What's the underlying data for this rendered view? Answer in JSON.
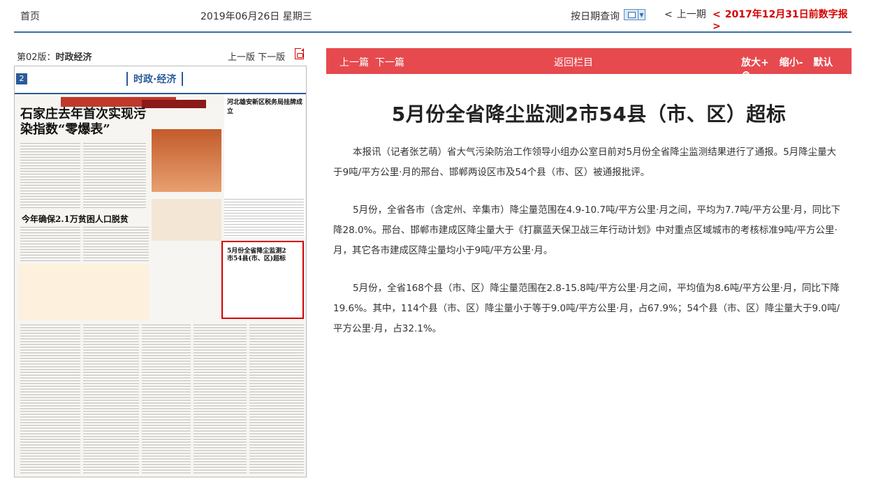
{
  "topbar": {
    "home": "首页",
    "date": "2019年06月26日 星期三",
    "query_label": "按日期查询",
    "prev_issue": "上一期",
    "latest_issue": "2017年12月31日前数字报"
  },
  "left_panel": {
    "version_label": "第02版：",
    "version_name": "时政经济",
    "prev_page": "上一版",
    "next_page": "下一版"
  },
  "newspaper": {
    "page_no": "2",
    "section": "时政·经济",
    "headline": "石家庄去年首次实现污染指数“零爆表”",
    "subhead": "今年确保2.1万贫困人口脱贫",
    "right_head": "河北雄安新区税务局挂牌成立",
    "highlight_title": "5月份全省降尘监测2市54县(市、区)超标"
  },
  "toolbar": {
    "prev_article": "上一篇",
    "next_article": "下一篇",
    "back_to_section": "返回栏目",
    "zoom_in": "放大+",
    "zoom_out": "缩小-",
    "default": "默认"
  },
  "article": {
    "title": "5月份全省降尘监测2市54县（市、区）超标",
    "paragraphs": [
      "本报讯（记者张艺萌）省大气污染防治工作领导小组办公室日前对5月份全省降尘监测结果进行了通报。5月降尘量大于9吨/平方公里·月的邢台、邯郸两设区市及54个县（市、区）被通报批评。",
      "5月份，全省各市（含定州、辛集市）降尘量范围在4.9-10.7吨/平方公里·月之间，平均为7.7吨/平方公里·月，同比下降28.0%。邢台、邯郸市建成区降尘量大于《打赢蓝天保卫战三年行动计划》中对重点区域城市的考核标准9吨/平方公里·月，其它各市建成区降尘量均小于9吨/平方公里·月。",
      "5月份，全省168个县（市、区）降尘量范围在2.8-15.8吨/平方公里·月之间，平均值为8.6吨/平方公里·月，同比下降19.6%。其中，114个县（市、区）降尘量小于等于9.0吨/平方公里·月，占67.9%；54个县（市、区）降尘量大于9.0吨/平方公里·月，占32.1%。"
    ]
  }
}
